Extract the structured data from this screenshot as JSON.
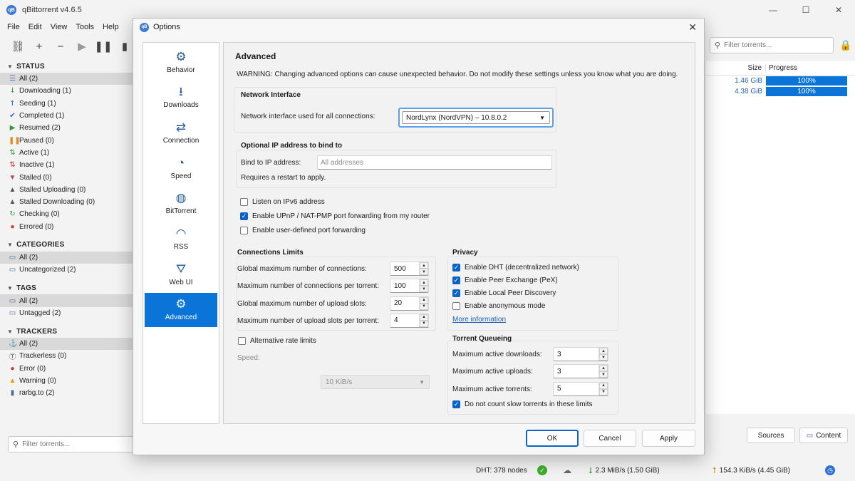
{
  "app": {
    "logo_text": "qB",
    "title": "qBittorrent v4.6.5",
    "window_controls": {
      "minimize": "—",
      "maximize": "☐",
      "close": "✕"
    }
  },
  "menu": [
    "File",
    "Edit",
    "View",
    "Tools",
    "Help"
  ],
  "toolbar": {
    "filter_placeholder": "Filter torrents..."
  },
  "sidebar": {
    "status_title": "STATUS",
    "status_items": [
      {
        "label": "All (2)",
        "icon": "☰",
        "color": "#5a7aa0"
      },
      {
        "label": "Downloading (1)",
        "icon": "⭣",
        "color": "#2e9a3a"
      },
      {
        "label": "Seeding (1)",
        "icon": "⭡",
        "color": "#2b63c8"
      },
      {
        "label": "Completed (1)",
        "icon": "✔",
        "color": "#2b63c8"
      },
      {
        "label": "Resumed (2)",
        "icon": "▶",
        "color": "#2e9a3a"
      },
      {
        "label": "Paused (0)",
        "icon": "❚❚",
        "color": "#e08a20"
      },
      {
        "label": "Active (1)",
        "icon": "⇅",
        "color": "#2e9a3a"
      },
      {
        "label": "Inactive (1)",
        "icon": "⇅",
        "color": "#c03030"
      },
      {
        "label": "Stalled (0)",
        "icon": "▼",
        "color": "#b04a7a"
      },
      {
        "label": "Stalled Uploading (0)",
        "icon": "▲",
        "color": "#555555"
      },
      {
        "label": "Stalled Downloading (0)",
        "icon": "▲",
        "color": "#555555"
      },
      {
        "label": "Checking (0)",
        "icon": "↻",
        "color": "#2e9a3a"
      },
      {
        "label": "Errored (0)",
        "icon": "●",
        "color": "#d03030"
      }
    ],
    "categories_title": "CATEGORIES",
    "categories_items": [
      "All (2)",
      "Uncategorized (2)"
    ],
    "tags_title": "TAGS",
    "tags_items": [
      "All (2)",
      "Untagged (2)"
    ],
    "trackers_title": "TRACKERS",
    "trackers_items": [
      {
        "label": "All (2)",
        "icon": "⚓",
        "color": "#4a6a9a"
      },
      {
        "label": "Trackerless (0)",
        "icon": "Ⓣ",
        "color": "#555555"
      },
      {
        "label": "Error (0)",
        "icon": "●",
        "color": "#d03030"
      },
      {
        "label": "Warning (0)",
        "icon": "▲",
        "color": "#e0a400"
      },
      {
        "label": "rarbg.to (2)",
        "icon": "▮",
        "color": "#4a6a9a"
      }
    ],
    "filter_placeholder": "Filter torrents..."
  },
  "torrents": {
    "col_size": "Size",
    "col_progress": "Progress",
    "rows": [
      {
        "size": "1.46 GiB",
        "progress": "100%",
        "progress_fraction": 1.0
      },
      {
        "size": "4.38 GiB",
        "progress": "100%",
        "progress_fraction": 1.0
      }
    ],
    "sources_button": "Sources",
    "content_button": "Content"
  },
  "statusbar": {
    "dht": "DHT: 378 nodes",
    "download": "2.3 MiB/s (1.50 GiB)",
    "upload": "154.3 KiB/s (4.45 GiB)"
  },
  "dialog": {
    "title": "Options",
    "close": "✕",
    "nav": [
      {
        "label": "Behavior",
        "icon": "⚙"
      },
      {
        "label": "Downloads",
        "icon": "⭳"
      },
      {
        "label": "Connection",
        "icon": "⇄"
      },
      {
        "label": "Speed",
        "icon": "◔"
      },
      {
        "label": "BitTorrent",
        "icon": "◍"
      },
      {
        "label": "RSS",
        "icon": "◠"
      },
      {
        "label": "Web UI",
        "icon": "⛛"
      },
      {
        "label": "Advanced",
        "icon": "⚙"
      }
    ],
    "selected_nav": "Advanced",
    "panel_title": "Advanced",
    "warning": "WARNING: Changing advanced options can cause unexpected behavior. Do not modify these settings unless you know what you are doing.",
    "network_interface": {
      "title": "Network Interface",
      "label": "Network interface used for all connections:",
      "value": "NordLynx (NordVPN) – 10.8.0.2"
    },
    "bind_ip": {
      "title": "Optional IP address to bind to",
      "label": "Bind to IP address:",
      "placeholder": "All addresses",
      "note": "Requires a restart to apply."
    },
    "checkboxes": [
      {
        "label": "Listen on IPv6 address",
        "checked": false
      },
      {
        "label": "Enable UPnP / NAT-PMP port forwarding from my router",
        "checked": true
      },
      {
        "label": "Enable user-defined port forwarding",
        "checked": false
      }
    ],
    "connections_limits": {
      "title": "Connections Limits",
      "rows": [
        {
          "label": "Global maximum number of connections:",
          "value": "500"
        },
        {
          "label": "Maximum number of connections per torrent:",
          "value": "100"
        },
        {
          "label": "Global maximum number of upload slots:",
          "value": "20"
        },
        {
          "label": "Maximum number of upload slots per torrent:",
          "value": "4"
        }
      ]
    },
    "alt_rate": {
      "label": "Alternative rate limits",
      "checked": false,
      "speed_label": "Speed:",
      "speed_value": "10 KiB/s"
    },
    "privacy": {
      "title": "Privacy",
      "items": [
        {
          "label": "Enable DHT (decentralized network)",
          "checked": true
        },
        {
          "label": "Enable Peer Exchange (PeX)",
          "checked": true
        },
        {
          "label": "Enable Local Peer Discovery",
          "checked": true
        },
        {
          "label": "Enable anonymous mode",
          "checked": false
        }
      ],
      "more_info": "More information"
    },
    "queueing": {
      "title": "Torrent Queueing",
      "rows": [
        {
          "label": "Maximum active downloads:",
          "value": "3"
        },
        {
          "label": "Maximum active uploads:",
          "value": "3"
        },
        {
          "label": "Maximum active torrents:",
          "value": "5"
        }
      ],
      "slow_label": "Do not count slow torrents in these limits",
      "slow_checked": true
    },
    "buttons": {
      "ok": "OK",
      "cancel": "Cancel",
      "apply": "Apply"
    }
  }
}
